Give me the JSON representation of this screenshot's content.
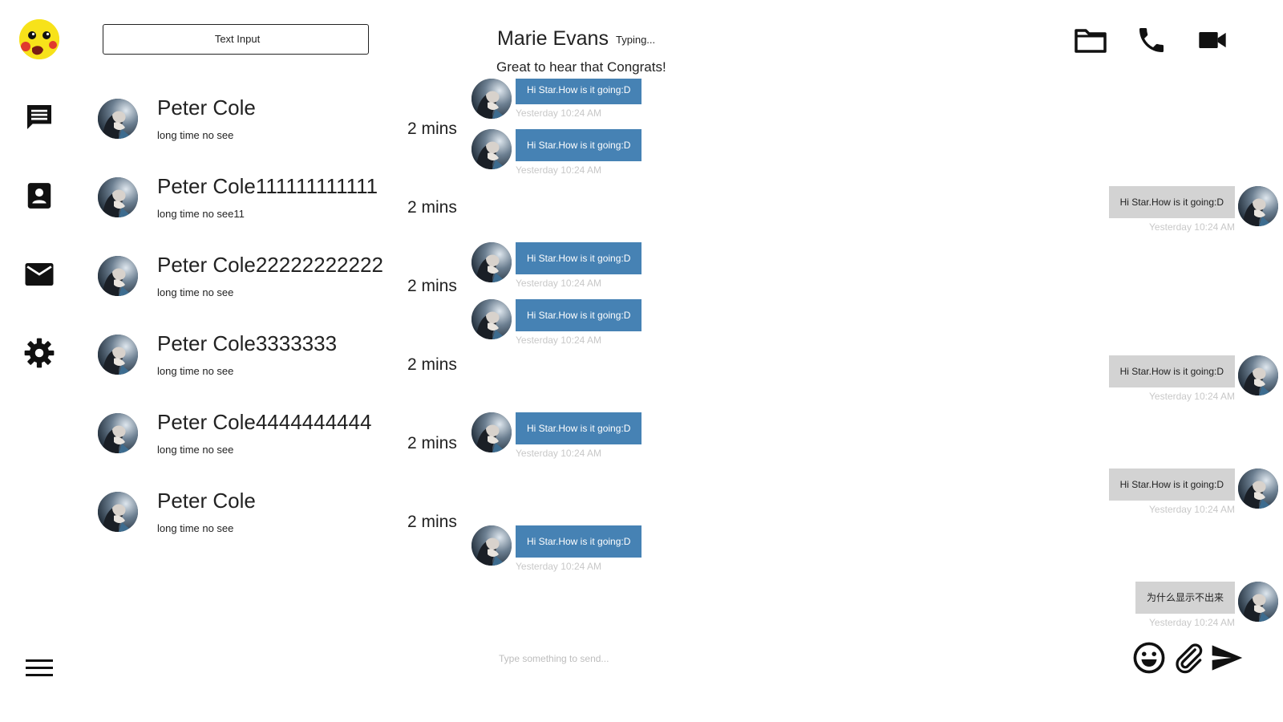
{
  "search": {
    "placeholder": "Text Input"
  },
  "rail": {
    "items": [
      {
        "icon": "chat-icon"
      },
      {
        "icon": "contact-card-icon"
      },
      {
        "icon": "mail-icon"
      },
      {
        "icon": "gear-icon"
      }
    ],
    "menu_icon": "hamburger-icon"
  },
  "contacts": [
    {
      "name": "Peter Cole",
      "preview": "long time no see",
      "time": "2 mins"
    },
    {
      "name": "Peter Cole111111111111",
      "preview": "long time no see11",
      "time": "2 mins"
    },
    {
      "name": "Peter Cole22222222222",
      "preview": "long time no see",
      "time": "2 mins"
    },
    {
      "name": "Peter Cole3333333",
      "preview": "long time no see",
      "time": "2 mins"
    },
    {
      "name": "Peter Cole4444444444",
      "preview": "long time no see",
      "time": "2 mins"
    },
    {
      "name": "Peter Cole",
      "preview": "long time no see",
      "time": "2 mins"
    }
  ],
  "chat": {
    "name": "Marie Evans",
    "typing": "Typing...",
    "status": "Great to hear that Congrats!",
    "header_icons": [
      "folder-icon",
      "phone-icon",
      "video-camera-icon"
    ]
  },
  "messages": {
    "incoming": [
      {
        "text": "Hi Star.How is it going:D",
        "time": "Yesterday 10:24 AM"
      },
      {
        "text": "Hi Star.How is it going:D",
        "time": "Yesterday 10:24 AM"
      },
      {
        "text": "Hi Star.How is it going:D",
        "time": "Yesterday 10:24 AM"
      },
      {
        "text": "Hi Star.How is it going:D",
        "time": "Yesterday 10:24 AM"
      },
      {
        "text": "Hi Star.How is it going:D",
        "time": "Yesterday 10:24 AM"
      },
      {
        "text": "Hi Star.How is it going:D",
        "time": "Yesterday 10:24 AM"
      }
    ],
    "outgoing": [
      {
        "text": "Hi Star.How is it going:D",
        "time": "Yesterday 10:24 AM"
      },
      {
        "text": "Hi Star.How is it going:D",
        "time": "Yesterday 10:24 AM"
      },
      {
        "text": "Hi Star.How is it going:D",
        "time": "Yesterday 10:24 AM"
      },
      {
        "text": "为什么显示不出来",
        "time": "Yesterday 10:24 AM"
      }
    ]
  },
  "composer": {
    "placeholder": "Type something to send...",
    "tool_icons": [
      "emoji-icon",
      "paperclip-icon",
      "send-icon"
    ]
  },
  "colors": {
    "incoming_bubble": "#4682b4",
    "outgoing_bubble": "#d3d3d3",
    "logo_yellow": "#f7e21a"
  }
}
